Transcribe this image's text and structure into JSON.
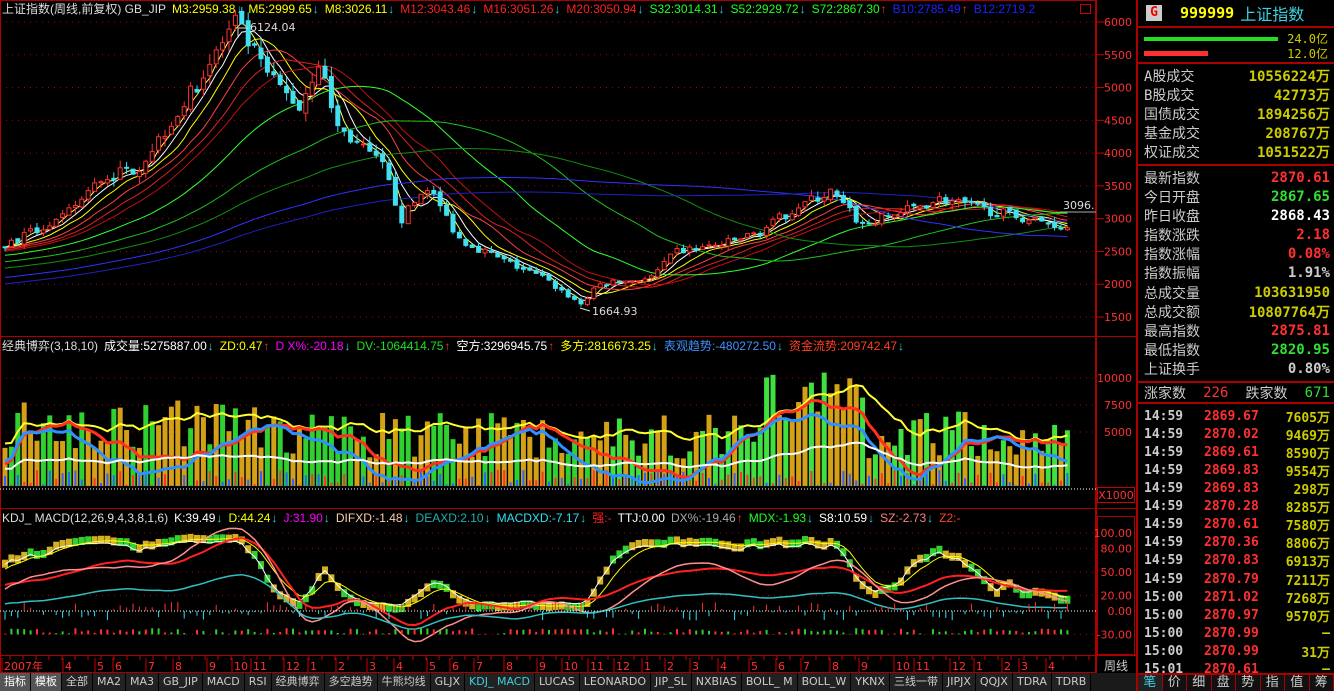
{
  "main_legend": {
    "title": "上证指数(周线,前复权) GB_JIP",
    "items": [
      {
        "t": "M3:2959.38",
        "c": "#ffff00",
        "d": "dn"
      },
      {
        "t": "M5:2999.65",
        "c": "#ffff00",
        "d": "dn"
      },
      {
        "t": "M8:3026.11",
        "c": "#ffff00",
        "d": "dn"
      },
      {
        "t": "M12:3043.46",
        "c": "#ff2020",
        "d": "dn"
      },
      {
        "t": "M16:3051.26",
        "c": "#ff2020",
        "d": "dn"
      },
      {
        "t": "M20:3050.94",
        "c": "#ff2020",
        "d": "dn"
      },
      {
        "t": "S32:3014.31",
        "c": "#20ff20",
        "d": "dn"
      },
      {
        "t": "S52:2929.72",
        "c": "#20ff20",
        "d": "dn"
      },
      {
        "t": "S72:2867.30",
        "c": "#20ff20",
        "d": "up"
      },
      {
        "t": "B10:2785.49",
        "c": "#2020ff",
        "d": "up"
      },
      {
        "t": "B12:2719.2",
        "c": "#2020ff",
        "d": ""
      }
    ]
  },
  "price_labels": {
    "high": "6124.04",
    "low": "1664.93",
    "last": "3096."
  },
  "price_axis": [
    "6000",
    "5500",
    "5000",
    "4500",
    "4000",
    "3500",
    "3000",
    "2500",
    "2000",
    "1500"
  ],
  "vol_legend": {
    "title": "经典博弈(3,18,10)",
    "items": [
      {
        "t": "成交量:5275887.00",
        "c": "#ffffff",
        "d": "dn"
      },
      {
        "t": "ZD:0.47",
        "c": "#ffff00",
        "d": "up"
      },
      {
        "t": "D X%:-20.18",
        "c": "#ff00ff",
        "d": "dn"
      },
      {
        "t": "DV:-1064414.75",
        "c": "#20e020",
        "d": "up"
      },
      {
        "t": "空方:3296945.75",
        "c": "#ffffff",
        "d": "up"
      },
      {
        "t": "多方:2816673.25",
        "c": "#ffff00",
        "d": "dn"
      },
      {
        "t": "表观趋势:-480272.50",
        "c": "#4090ff",
        "d": "dn"
      },
      {
        "t": "资金流势:209742.47",
        "c": "#ff4020",
        "d": "dn"
      }
    ]
  },
  "vol_axis": [
    "10000",
    "7500",
    "5000"
  ],
  "vol_unit": "X1000",
  "kdj_legend": {
    "title": "KDJ_ MACD(12,26,9,4,3,8,1,6)",
    "items": [
      {
        "t": "K:39.49",
        "c": "#ffffff",
        "d": "dn"
      },
      {
        "t": "D:44.24",
        "c": "#ffff00",
        "d": "dn"
      },
      {
        "t": "J:31.90",
        "c": "#ff00ff",
        "d": "dn"
      },
      {
        "t": "DIFXD:-1.48",
        "c": "#ffccaa",
        "d": "dn"
      },
      {
        "t": "DEAXD:2.10",
        "c": "#20b0b0",
        "d": "dn"
      },
      {
        "t": "MACDXD:-7.17",
        "c": "#30e0f0",
        "d": "dn"
      },
      {
        "t": "强:-",
        "c": "#ff2020",
        "d": ""
      },
      {
        "t": "TTJ:0.00",
        "c": "#ffffff",
        "d": ""
      },
      {
        "t": "DX%:-19.46",
        "c": "#aaaaaa",
        "d": "up"
      },
      {
        "t": "MDX:-1.93",
        "c": "#20ff20",
        "d": "dn"
      },
      {
        "t": "S8:10.59",
        "c": "#ffffff",
        "d": "dn"
      },
      {
        "t": "SZ:-2.73",
        "c": "#ff8080",
        "d": "dn"
      },
      {
        "t": "Z2:-",
        "c": "#ff4020",
        "d": ""
      }
    ]
  },
  "kdj_axis": [
    "100.00",
    "80.00",
    "50.00",
    "20.00",
    "0.00",
    "-30.00"
  ],
  "period_label": "周线",
  "time_axis": [
    "2007年",
    "4",
    "5",
    "6",
    "7",
    "8",
    "9",
    "10",
    "11",
    "12",
    "1",
    "2",
    "3",
    "4",
    "5",
    "6",
    "7",
    "8",
    "9",
    "10",
    "11",
    "12",
    "1",
    "2",
    "3",
    "4",
    "5",
    "6",
    "7",
    "8",
    "9",
    "10",
    "11",
    "12",
    "1",
    "2",
    "3",
    "4"
  ],
  "chart_data": {
    "type": "candlestick",
    "waypoints": [
      [
        0,
        2600
      ],
      [
        9,
        3000
      ],
      [
        15,
        3600
      ],
      [
        21,
        3800
      ],
      [
        29,
        4900
      ],
      [
        36,
        6000
      ],
      [
        41,
        5200
      ],
      [
        46,
        4700
      ],
      [
        49,
        5400
      ],
      [
        52,
        4400
      ],
      [
        59,
        3800
      ],
      [
        62,
        3000
      ],
      [
        66,
        3500
      ],
      [
        71,
        2700
      ],
      [
        77,
        2400
      ],
      [
        84,
        2100
      ],
      [
        90,
        1700
      ],
      [
        93,
        2000
      ],
      [
        101,
        2100
      ],
      [
        105,
        2500
      ],
      [
        112,
        2600
      ],
      [
        118,
        2800
      ],
      [
        124,
        3200
      ],
      [
        129,
        3400
      ],
      [
        134,
        2900
      ],
      [
        140,
        3100
      ],
      [
        146,
        3300
      ],
      [
        155,
        3100
      ],
      [
        166,
        2870
      ]
    ]
  },
  "panel": {
    "code": "999999",
    "name": "上证指数",
    "g": "G",
    "bar1": "24.0亿",
    "bar2": "12.0亿",
    "turnover": [
      {
        "l": "A股成交",
        "v": "10556224万"
      },
      {
        "l": "B股成交",
        "v": "42773万"
      },
      {
        "l": "国债成交",
        "v": "1894256万"
      },
      {
        "l": "基金成交",
        "v": "208767万"
      },
      {
        "l": "权证成交",
        "v": "1051522万"
      }
    ],
    "quote": [
      {
        "l": "最新指数",
        "v": "2870.61",
        "c": "#ff3030"
      },
      {
        "l": "今日开盘",
        "v": "2867.65",
        "c": "#30e030"
      },
      {
        "l": "昨日收盘",
        "v": "2868.43",
        "c": "#ffffff"
      },
      {
        "l": "指数涨跌",
        "v": "2.18",
        "c": "#ff3030"
      },
      {
        "l": "指数涨幅",
        "v": "0.08%",
        "c": "#ff3030"
      },
      {
        "l": "指数振幅",
        "v": "1.91%",
        "c": "#cccccc"
      },
      {
        "l": "总成交量",
        "v": "103631950",
        "c": "#cccc00"
      },
      {
        "l": "总成交额",
        "v": "10807764万",
        "c": "#cccc00"
      },
      {
        "l": "最高指数",
        "v": "2875.81",
        "c": "#ff3030"
      },
      {
        "l": "最低指数",
        "v": "2820.95",
        "c": "#30e030"
      },
      {
        "l": "上证换手",
        "v": "0.80%",
        "c": "#cccccc"
      }
    ],
    "adv": {
      "l1": "涨家数",
      "v1": "226",
      "l2": "跌家数",
      "v2": "671"
    },
    "ticks": [
      [
        "14:59",
        "2869.67",
        "7605万"
      ],
      [
        "14:59",
        "2870.02",
        "9469万"
      ],
      [
        "14:59",
        "2869.61",
        "8590万"
      ],
      [
        "14:59",
        "2869.83",
        "9554万"
      ],
      [
        "14:59",
        "2869.83",
        "298万"
      ],
      [
        "14:59",
        "2870.28",
        "8285万"
      ],
      [
        "14:59",
        "2870.61",
        "7580万"
      ],
      [
        "14:59",
        "2870.36",
        "8806万"
      ],
      [
        "14:59",
        "2870.83",
        "6913万"
      ],
      [
        "14:59",
        "2870.79",
        "7211万"
      ],
      [
        "15:00",
        "2871.02",
        "7268万"
      ],
      [
        "15:00",
        "2870.97",
        "9570万"
      ],
      [
        "15:00",
        "2870.99",
        "—"
      ],
      [
        "15:00",
        "2870.99",
        "31万"
      ],
      [
        "15:01",
        "2870.61",
        "—"
      ]
    ],
    "tabs": [
      "笔",
      "价",
      "细",
      "盘",
      "势",
      "指",
      "值",
      "筹"
    ]
  },
  "bottom_tabs": [
    "指标",
    "模板",
    "全部",
    "MA2",
    "MA3",
    "GB_JIP",
    "MACD",
    "RSI",
    "经典博弈",
    "多空趋势",
    "牛熊均线",
    "GLJX",
    "KDJ_ MACD",
    "LUCAS",
    "LEONARDO",
    "JIP_SL",
    "NXBIAS",
    "BOLL_ M",
    "BOLL_W",
    "YKNX",
    "三线一带",
    "JIPJX",
    "QQJX",
    "TDRA",
    "TDRB"
  ]
}
